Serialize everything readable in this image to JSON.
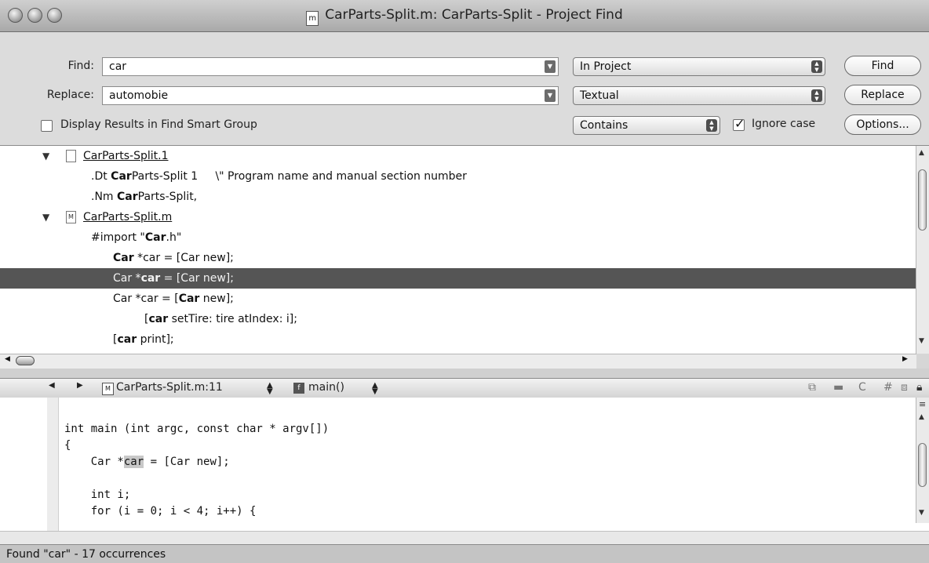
{
  "window": {
    "title": "CarParts-Split.m: CarParts-Split - Project Find",
    "title_icon": "m"
  },
  "find": {
    "find_label": "Find:",
    "find_value": "car",
    "replace_label": "Replace:",
    "replace_value": "automobie",
    "scope": "In Project",
    "mode": "Textual",
    "match": "Contains",
    "ignore_case_label": "Ignore case",
    "ignore_case_checked": true,
    "smart_group_label": "Display Results in Find Smart Group",
    "smart_group_checked": false,
    "find_button": "Find",
    "replace_button": "Replace",
    "options_button": "Options..."
  },
  "results": {
    "files": [
      {
        "name": "CarParts-Split.1",
        "icon": "doc-icon",
        "lines": [
          {
            "parts": [
              ".Dt ",
              "Car",
              "Parts-Split 1     \\\" Program name and manual section number"
            ]
          },
          {
            "parts": [
              ".Nm ",
              "Car",
              "Parts-Split,"
            ]
          }
        ]
      },
      {
        "name": "CarParts-Split.m",
        "icon": "m-file-icon",
        "lines": [
          {
            "parts": [
              "#import \"",
              "Car",
              ".h\""
            ]
          },
          {
            "parts": [
              "",
              "Car",
              " *car = [Car new];"
            ]
          },
          {
            "parts": [
              "Car *",
              "car",
              " = [Car new];"
            ],
            "selected": true
          },
          {
            "parts": [
              "Car *car = [",
              "Car",
              " new];"
            ]
          },
          {
            "parts": [
              "[",
              "car",
              " setTire: tire atIndex: i];"
            ]
          },
          {
            "parts": [
              "[",
              "car",
              " print];"
            ]
          }
        ]
      }
    ]
  },
  "editor": {
    "file_popup": "CarParts-Split.m:11",
    "function_popup": "main()",
    "code_lines": [
      "int main (int argc, const char * argv[])",
      "{",
      "    Car *car = [Car new];",
      "",
      "    int i;",
      "    for (i = 0; i < 4; i++) {"
    ],
    "highlight": "car"
  },
  "status": {
    "text": "Found \"car\" - 17 occurrences"
  }
}
